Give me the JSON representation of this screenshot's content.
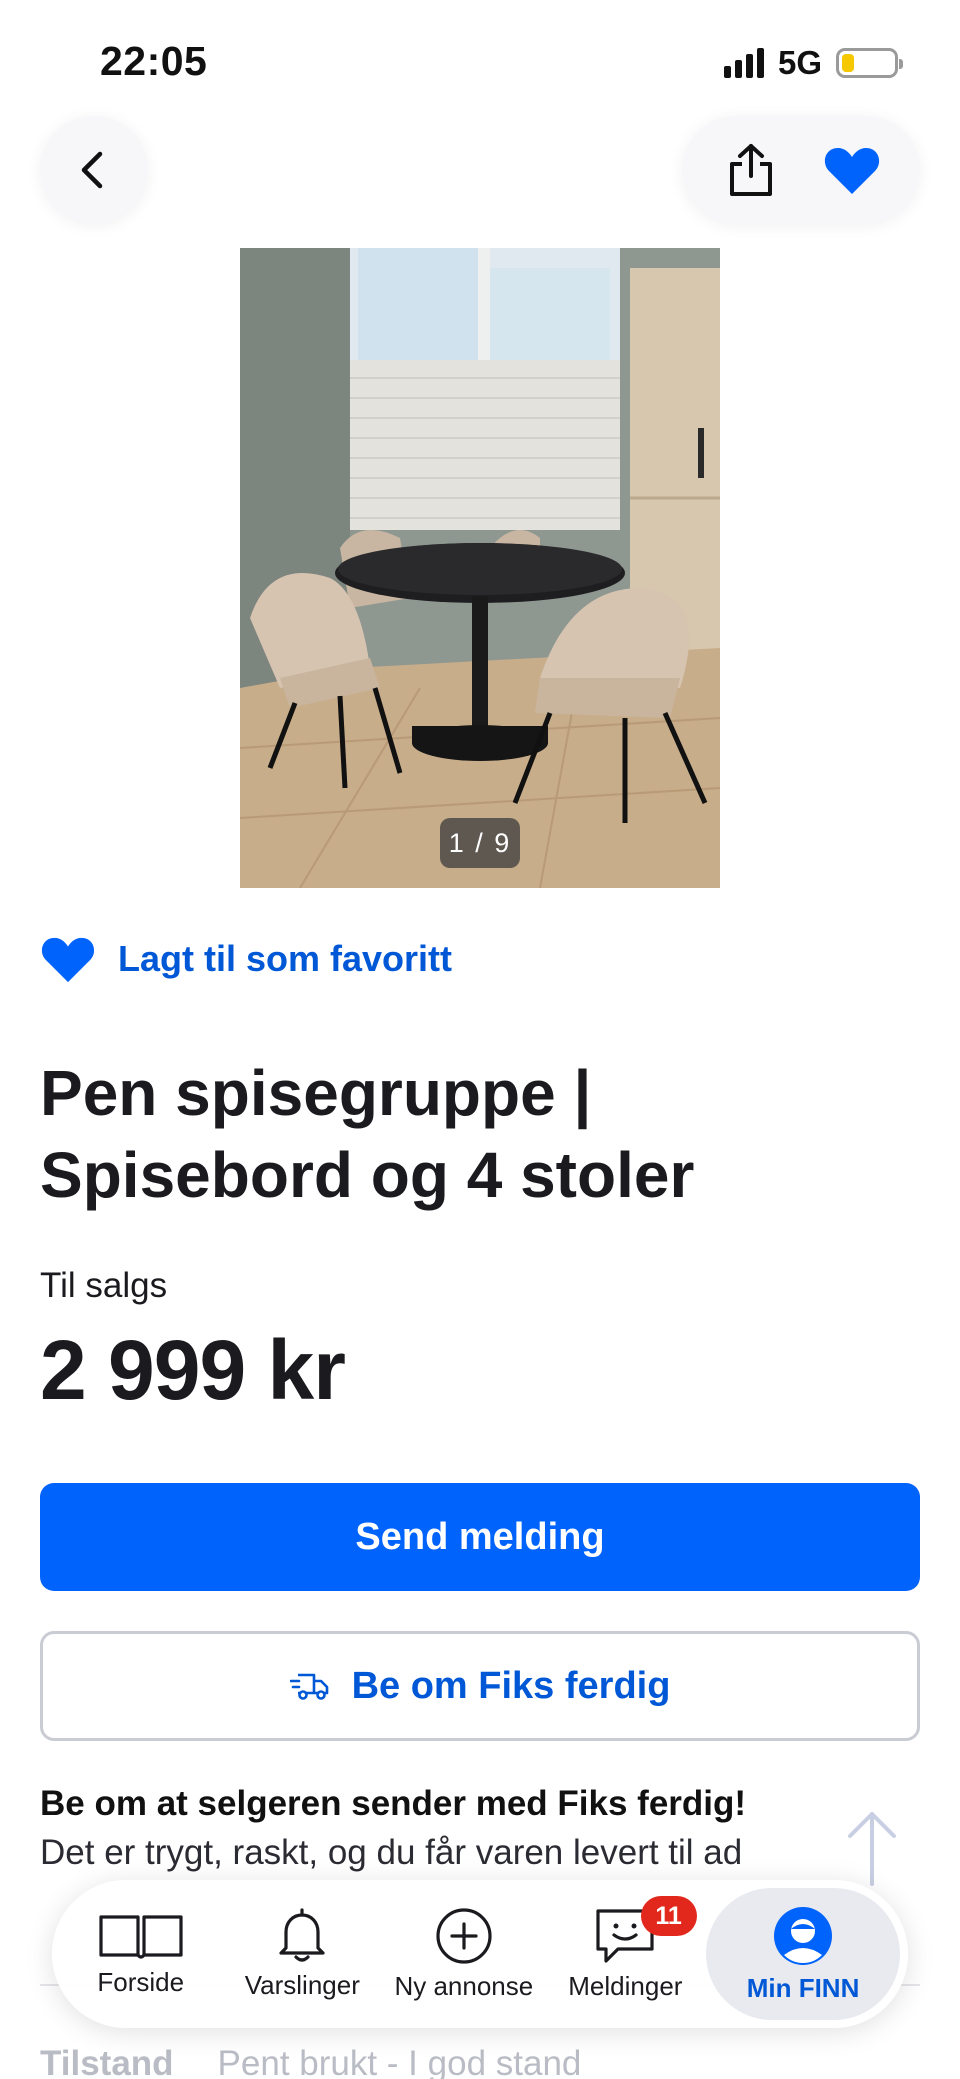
{
  "status_bar": {
    "time": "22:05",
    "network": "5G"
  },
  "top_bar": {
    "back_icon": "chevron-left-icon",
    "share_icon": "share-icon",
    "favorite_icon": "heart-filled-icon"
  },
  "gallery": {
    "counter": "1 / 9"
  },
  "favorite": {
    "label": "Lagt til som favoritt",
    "color": "#0063fb"
  },
  "listing": {
    "title": "Pen spisegruppe | Spisebord og 4 stoler",
    "sale_type": "Til salgs",
    "price": "2 999 kr"
  },
  "actions": {
    "send_message": "Send melding",
    "fiks_ferdig": "Be om Fiks ferdig",
    "fiks_icon": "delivery-truck-icon"
  },
  "fiks_info": {
    "title": "Be om at selgeren sender med Fiks ferdig!",
    "body": "Det er trygt, raskt, og du får varen levert til ad"
  },
  "details_preview": {
    "label": "Tilstand",
    "value": "Pent brukt - I god stand"
  },
  "bottom_nav": {
    "items": [
      {
        "label": "Forside",
        "icon": "open-book-icon"
      },
      {
        "label": "Varslinger",
        "icon": "bell-icon"
      },
      {
        "label": "Ny annonse",
        "icon": "plus-circle-icon"
      },
      {
        "label": "Meldinger",
        "icon": "chat-smile-icon",
        "badge": "11"
      },
      {
        "label": "Min FINN",
        "icon": "user-avatar-icon",
        "active": true
      }
    ]
  },
  "colors": {
    "accent": "#0063fb",
    "badge": "#e2281c",
    "text": "#1a1a1f"
  }
}
